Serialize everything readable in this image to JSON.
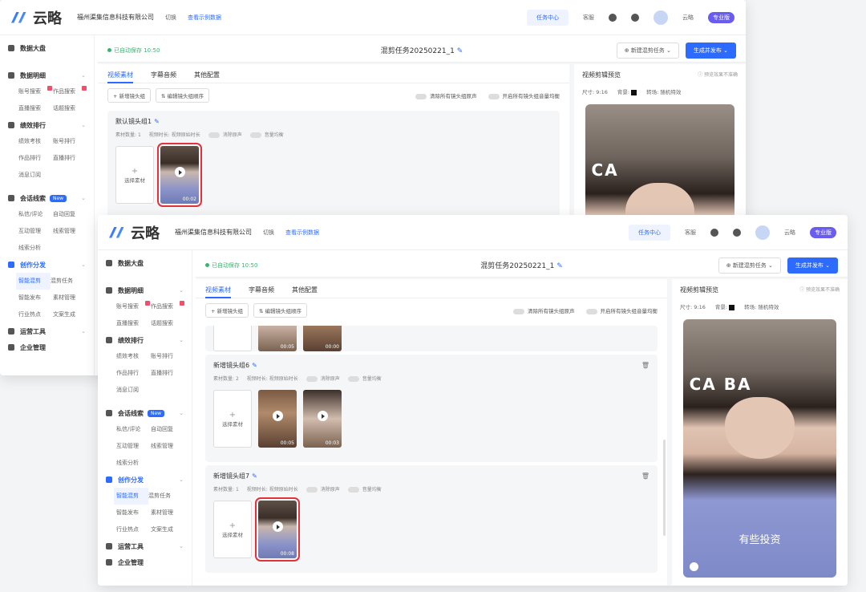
{
  "app": {
    "logo_text": "云略",
    "company": "福州渠集信息科技有限公司",
    "switch": "切换",
    "example": "查看示例数据"
  },
  "topbar": {
    "task_center": "任务中心",
    "service": "客服",
    "user": "云略",
    "plan": "专业版"
  },
  "sidebar": {
    "dashboard": "数据大盘",
    "data_detail": {
      "label": "数据明细",
      "items": [
        "账号搜索",
        "作品搜索",
        "直播搜索",
        "话题搜索"
      ]
    },
    "ranking": {
      "label": "绩效排行",
      "items": [
        "绩效考核",
        "账号排行",
        "作品排行",
        "直播排行",
        "消息订阅"
      ]
    },
    "leads": {
      "label": "会话线索",
      "badge": "New",
      "items": [
        "私信/评论",
        "自动回复",
        "互动管理",
        "线索管理",
        "线索分析"
      ]
    },
    "creation": {
      "label": "创作分发",
      "items": [
        "智能混剪",
        "混剪任务",
        "智能发布",
        "素材管理",
        "行业热点",
        "文案生成"
      ]
    },
    "ops": {
      "label": "运营工具"
    },
    "enterprise": {
      "label": "企业管理"
    }
  },
  "editor": {
    "saved": "已自动保存 10:50",
    "title": "混剪任务20250221_1",
    "new_task": "新建混剪任务",
    "publish": "生成并发布",
    "tabs": [
      "视频素材",
      "字幕音频",
      "其他配置"
    ],
    "add_group": "新增镜头组",
    "order_groups": "编辑镜头组顺序",
    "clear_all": "清除所有镜头组原声",
    "balance_all": "开启所有镜头组音量均衡",
    "meta_count_label": "素材数量:",
    "meta_duration": "视频时长: 视频原始时长",
    "meta_remove": "消除原声",
    "meta_balance": "音量均衡",
    "add_material": "选择素材"
  },
  "back_window": {
    "group_name": "默认镜头组1",
    "group_count": "1",
    "clip_duration": "00:02"
  },
  "front_window": {
    "top_partial_durations": [
      "00:05",
      "00:00"
    ],
    "group6": {
      "name": "新增镜头组6",
      "count": "2",
      "durations": [
        "00:05",
        "00:03"
      ]
    },
    "group7": {
      "name": "新增镜头组7",
      "count": "1",
      "durations": [
        "00:08"
      ]
    }
  },
  "preview": {
    "title": "视频剪辑预览",
    "hint": "预览效果不准确",
    "size": "尺寸: 9:16",
    "bg": "背景:",
    "transition": "转场: 随机特效",
    "sign": "CA BA",
    "sign_back": "CA",
    "caption": "有些投资"
  }
}
